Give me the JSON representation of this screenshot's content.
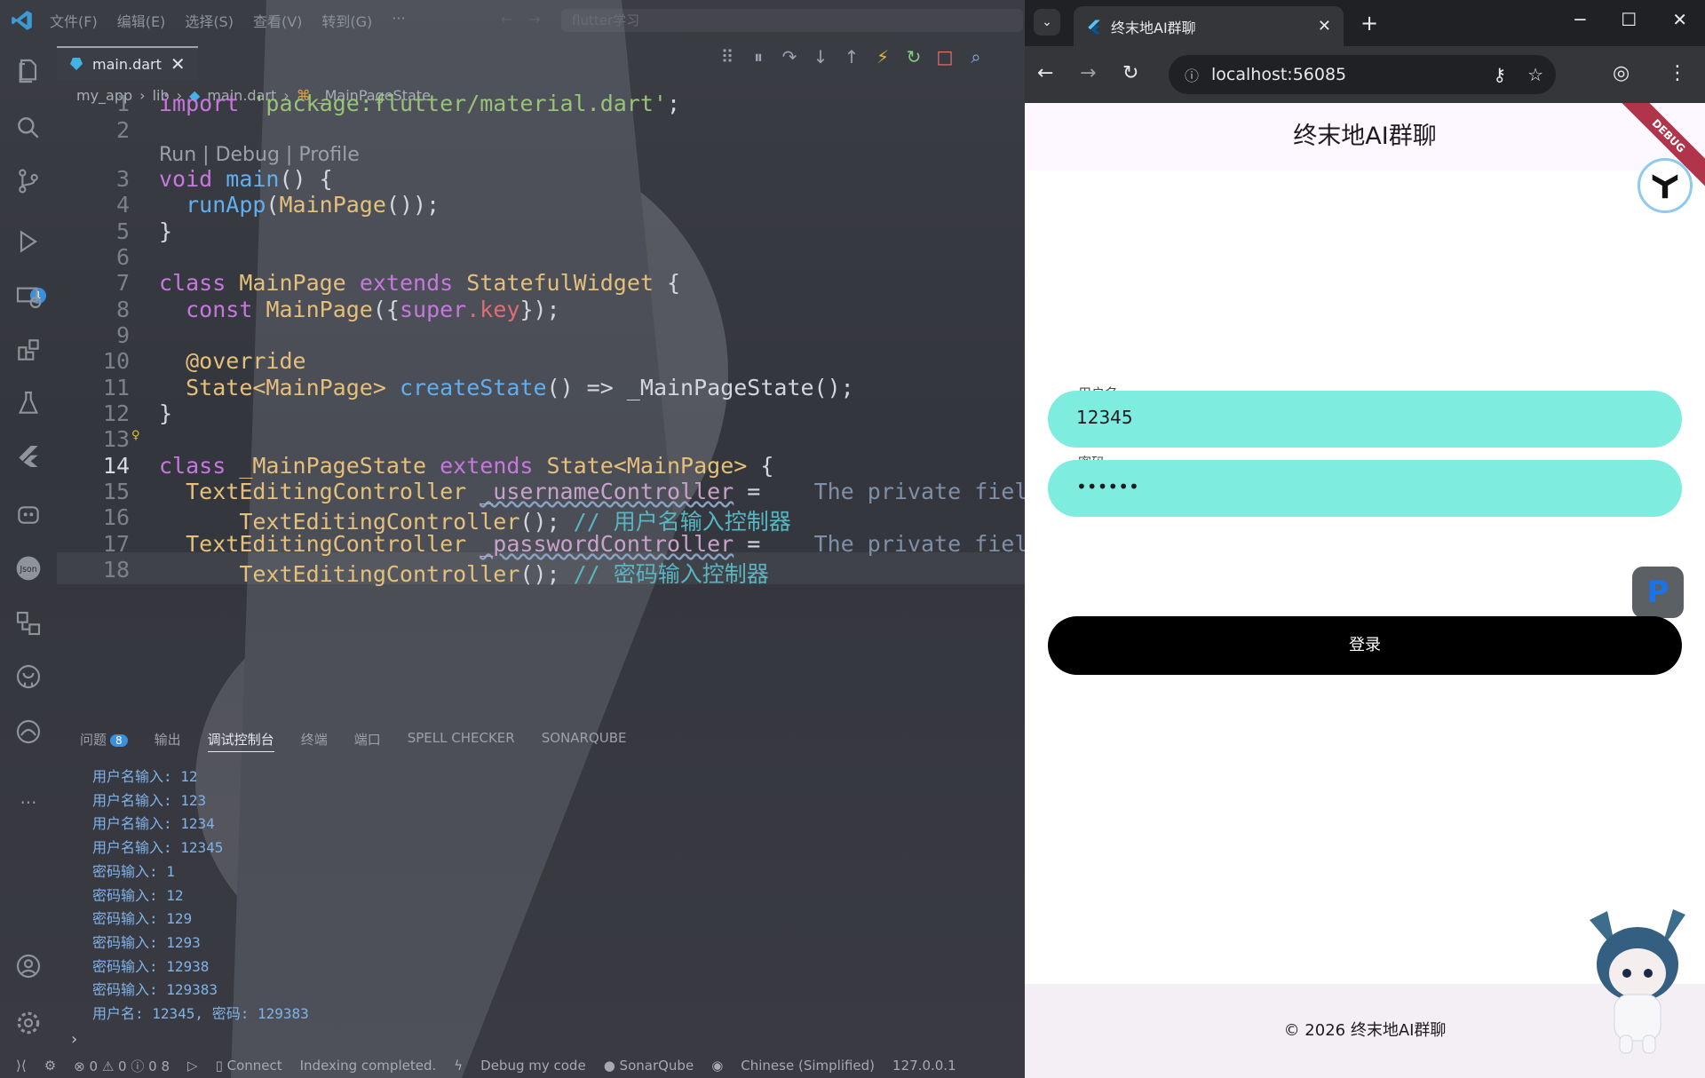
{
  "vscode": {
    "menu": [
      "文件(F)",
      "编辑(E)",
      "选择(S)",
      "查看(V)",
      "转到(G)",
      "···"
    ],
    "search": "flutter学习",
    "active_tab": "main.dart",
    "breadcrumb": [
      "my_app",
      "lib",
      "main.dart",
      "_MainPageState"
    ],
    "activity_badge": "1",
    "code_lens": "Run | Debug | Profile",
    "line_numbers": [
      "1",
      "2",
      "3",
      "4",
      "5",
      "6",
      "7",
      "8",
      "9",
      "10",
      "11",
      "12",
      "13",
      "14",
      "15",
      "16",
      "17",
      "18"
    ],
    "code": {
      "l1_kw": "import",
      "l1_str": "'package:flutter/material.dart'",
      "l1_end": ";",
      "l3_type": "void",
      "l3_fn": "main",
      "l3_rest": "() {",
      "l4_fn": "runApp",
      "l4_cls": "MainPage",
      "l4_rest": "());",
      "l5": "}",
      "l7_kw1": "class",
      "l7_cls": "MainPage",
      "l7_kw2": "extends",
      "l7_cls2": "StatefulWidget",
      "l7_end": "{",
      "l8_kw": "const",
      "l8_cls": "MainPage",
      "l8_p1": "({",
      "l8_super": "super",
      "l8_key": ".key",
      "l8_end": "});",
      "l10": "@override",
      "l11_cls": "State<MainPage>",
      "l11_fn": "createState",
      "l11_rest": "() => _MainPageState();",
      "l12": "}",
      "l14_kw1": "class",
      "l14_cls": "_MainPageState",
      "l14_kw2": "extends",
      "l14_cls2": "State<MainPage>",
      "l14_end": "{",
      "l15_cls": "TextEditingController",
      "l15_fd": "_usernameController",
      "l15_eq": "=",
      "l15_hint": "The private field",
      "l16_cls": "TextEditingController",
      "l16_rest": "();",
      "l16_cm": "// 用户名输入控制器",
      "l17_cls": "TextEditingController",
      "l17_fd": "_passwordController",
      "l17_eq": "=",
      "l17_hint": "The private field",
      "l18_cls": "TextEditingController",
      "l18_rest": "();",
      "l18_cm": "// 密码输入控制器"
    },
    "panel_tabs": [
      {
        "label": "问题",
        "count": "8"
      },
      {
        "label": "输出"
      },
      {
        "label": "调试控制台"
      },
      {
        "label": "终端"
      },
      {
        "label": "端口"
      },
      {
        "label": "SPELL CHECKER"
      },
      {
        "label": "SONARQUBE"
      }
    ],
    "console": [
      "用户名输入: 12",
      "用户名输入: 123",
      "用户名输入: 1234",
      "用户名输入: 12345",
      "密码输入: 1",
      "密码输入: 12",
      "密码输入: 129",
      "密码输入: 1293",
      "密码输入: 12938",
      "密码输入: 129383",
      "用户名: 12345, 密码: 129383"
    ],
    "status": [
      "0",
      "0",
      "0",
      "8",
      "Connect",
      "Indexing completed.",
      "Debug my code",
      "SonarQube",
      "Chinese (Simplified)",
      "127.0.0.1"
    ]
  },
  "browser": {
    "tab_title": "终末地AI群聊",
    "url": "localhost:56085",
    "app": {
      "title": "终末地AI群聊",
      "debug_banner": "DEBUG",
      "username_label": "用户名",
      "username_value": "12345",
      "password_label": "密码",
      "password_value": "••••••",
      "login_label": "登录",
      "footer": "© 2026 终末地AI群聊",
      "ext_letter": "P"
    }
  },
  "colors": {
    "field_bg": "#7eeddf",
    "button_bg": "#000000",
    "appbar_bg": "#fdf7ff",
    "footer_bg": "#f3eff5"
  }
}
